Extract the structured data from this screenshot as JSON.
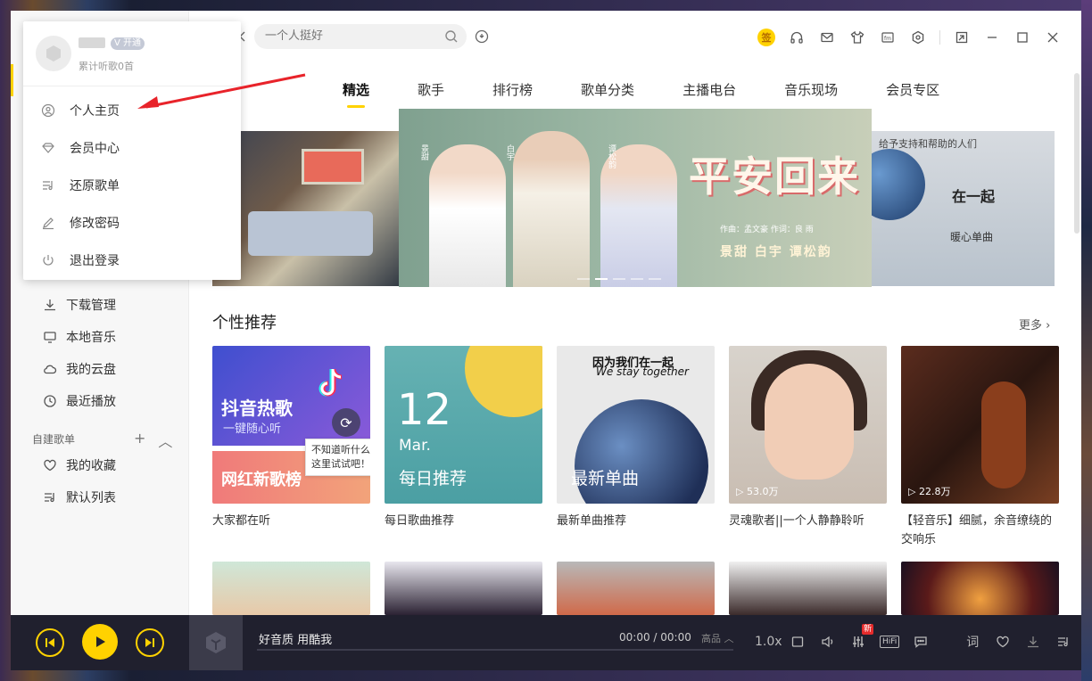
{
  "search": {
    "placeholder": "一个人挺好"
  },
  "topbar": {
    "sign_label": "签"
  },
  "tabs": [
    "精选",
    "歌手",
    "排行榜",
    "歌单分类",
    "主播电台",
    "音乐现场",
    "会员专区"
  ],
  "banner": {
    "title": "平安回来",
    "credits": "作曲：孟文豪  作词：良 雨",
    "cast": "景甜 白宇 谭松韵",
    "names": [
      "景甜",
      "白宇",
      "谭松韵"
    ],
    "right_line1": "给予支持和帮助的人们",
    "right_line2": "在一起",
    "right_line3": "暖心单曲"
  },
  "sidebar": {
    "items": [
      "下载管理",
      "本地音乐",
      "我的云盘",
      "最近播放"
    ],
    "section": "自建歌单",
    "section_add": "+",
    "section_collapse": "︿",
    "playlists": [
      "我的收藏",
      "默认列表"
    ]
  },
  "section": {
    "title": "个性推荐",
    "more": "更多 ›"
  },
  "cards": [
    {
      "caption": "大家都在听",
      "title1": "抖音热歌",
      "sub1": "一键随心听",
      "title2": "网红新歌榜"
    },
    {
      "caption": "每日歌曲推荐",
      "day": "12",
      "month": "Mar.",
      "title": "每日推荐"
    },
    {
      "caption": "最新单曲推荐",
      "headline": "因为我们在一起",
      "headline_en": "We stay together",
      "title": "最新单曲"
    },
    {
      "caption": "灵魂歌者||一个人静静聆听",
      "plays": "▷ 53.0万"
    },
    {
      "caption": "【轻音乐】细腻，余音缭绕的交响乐",
      "plays": "▷ 22.8万"
    }
  ],
  "tooltip": "不知道听什么点这里试试吧！",
  "dropdown": {
    "vip_label": "开通",
    "stat": "累计听歌0首",
    "items": [
      "个人主页",
      "会员中心",
      "还原歌单",
      "修改密码",
      "退出登录"
    ]
  },
  "player": {
    "song": "好音质 用酷我",
    "time": "00:00 / 00:00",
    "quality": "高品 ︿",
    "speed": "1.0x",
    "new_badge": "新",
    "hifi": "HiFi",
    "lyric": "词"
  },
  "colors": {
    "accent": "#ffd200",
    "player_bg": "#20202e"
  }
}
